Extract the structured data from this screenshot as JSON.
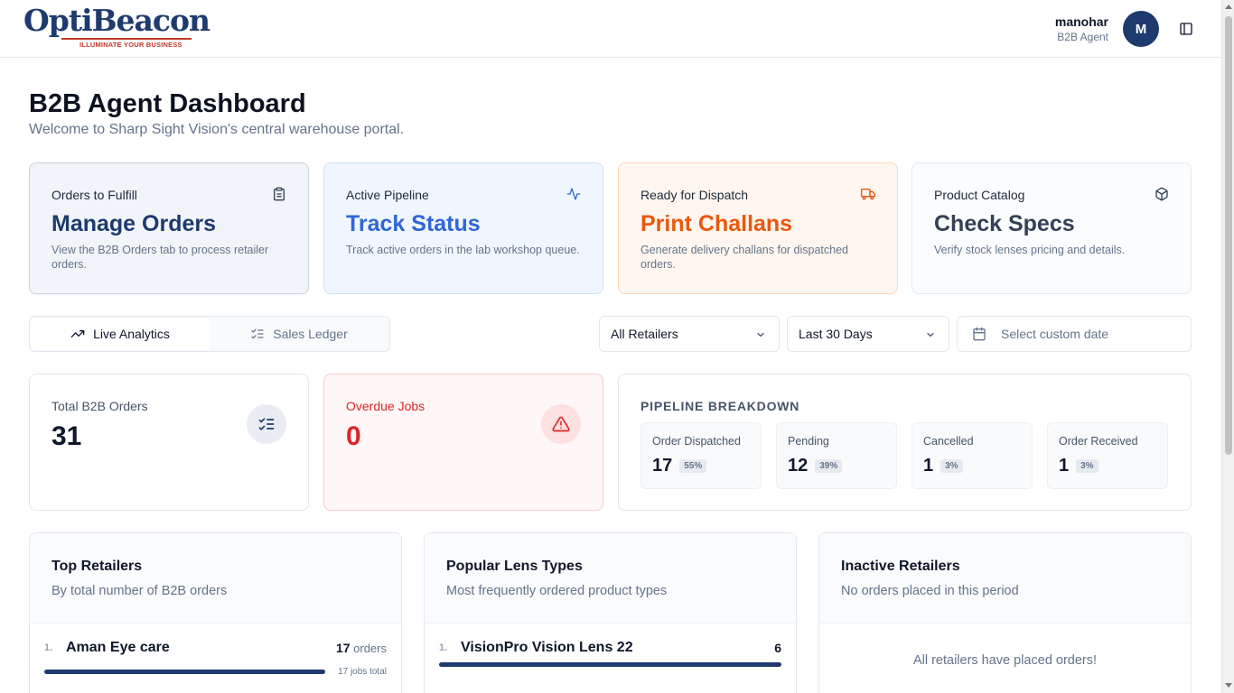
{
  "header": {
    "logo_text": "OptiBeacon",
    "logo_tagline": "ILLUMINATE YOUR BUSINESS",
    "user_name": "manohar",
    "user_role": "B2B Agent",
    "avatar_initial": "M"
  },
  "page": {
    "title": "B2B Agent Dashboard",
    "subtitle": "Welcome to Sharp Sight Vision's central warehouse portal."
  },
  "action_cards": [
    {
      "label": "Orders to Fulfill",
      "title": "Manage Orders",
      "desc": "View the B2B Orders tab to process retailer orders.",
      "icon": "clipboard-icon"
    },
    {
      "label": "Active Pipeline",
      "title": "Track Status",
      "desc": "Track active orders in the lab workshop queue.",
      "icon": "activity-icon"
    },
    {
      "label": "Ready for Dispatch",
      "title": "Print Challans",
      "desc": "Generate delivery challans for dispatched orders.",
      "icon": "truck-icon"
    },
    {
      "label": "Product Catalog",
      "title": "Check Specs",
      "desc": "Verify stock lenses pricing and details.",
      "icon": "package-icon"
    }
  ],
  "view_tabs": [
    {
      "label": "Live Analytics",
      "active": true
    },
    {
      "label": "Sales Ledger",
      "active": false
    }
  ],
  "filters": {
    "retailer": "All Retailers",
    "range": "Last 30 Days",
    "custom_date_placeholder": "Select custom date"
  },
  "stats": {
    "total_label": "Total B2B Orders",
    "total_value": "31",
    "overdue_label": "Overdue Jobs",
    "overdue_value": "0"
  },
  "pipeline": {
    "title": "PIPELINE BREAKDOWN",
    "items": [
      {
        "label": "Order Dispatched",
        "count": "17",
        "pct": "55%"
      },
      {
        "label": "Pending",
        "count": "12",
        "pct": "39%"
      },
      {
        "label": "Cancelled",
        "count": "1",
        "pct": "3%"
      },
      {
        "label": "Order Received",
        "count": "1",
        "pct": "3%"
      }
    ]
  },
  "top_retailers": {
    "title": "Top Retailers",
    "subtitle": "By total number of B2B orders",
    "rows": [
      {
        "rank": "1.",
        "name": "Aman Eye care",
        "count": "17",
        "unit": "orders",
        "jobs": "17 jobs total",
        "share": 1.0
      }
    ]
  },
  "lens_types": {
    "title": "Popular Lens Types",
    "subtitle": "Most frequently ordered product types",
    "rows": [
      {
        "rank": "1.",
        "name": "VisionPro Vision Lens 22",
        "count": "6",
        "share": 1.0
      }
    ]
  },
  "inactive_retailers": {
    "title": "Inactive Retailers",
    "subtitle": "No orders placed in this period",
    "empty_message": "All retailers have placed orders!"
  },
  "colors": {
    "brand": "#1e3a6e",
    "track": "#2f67d6",
    "dispatch": "#ea580c",
    "danger": "#dc2626"
  }
}
